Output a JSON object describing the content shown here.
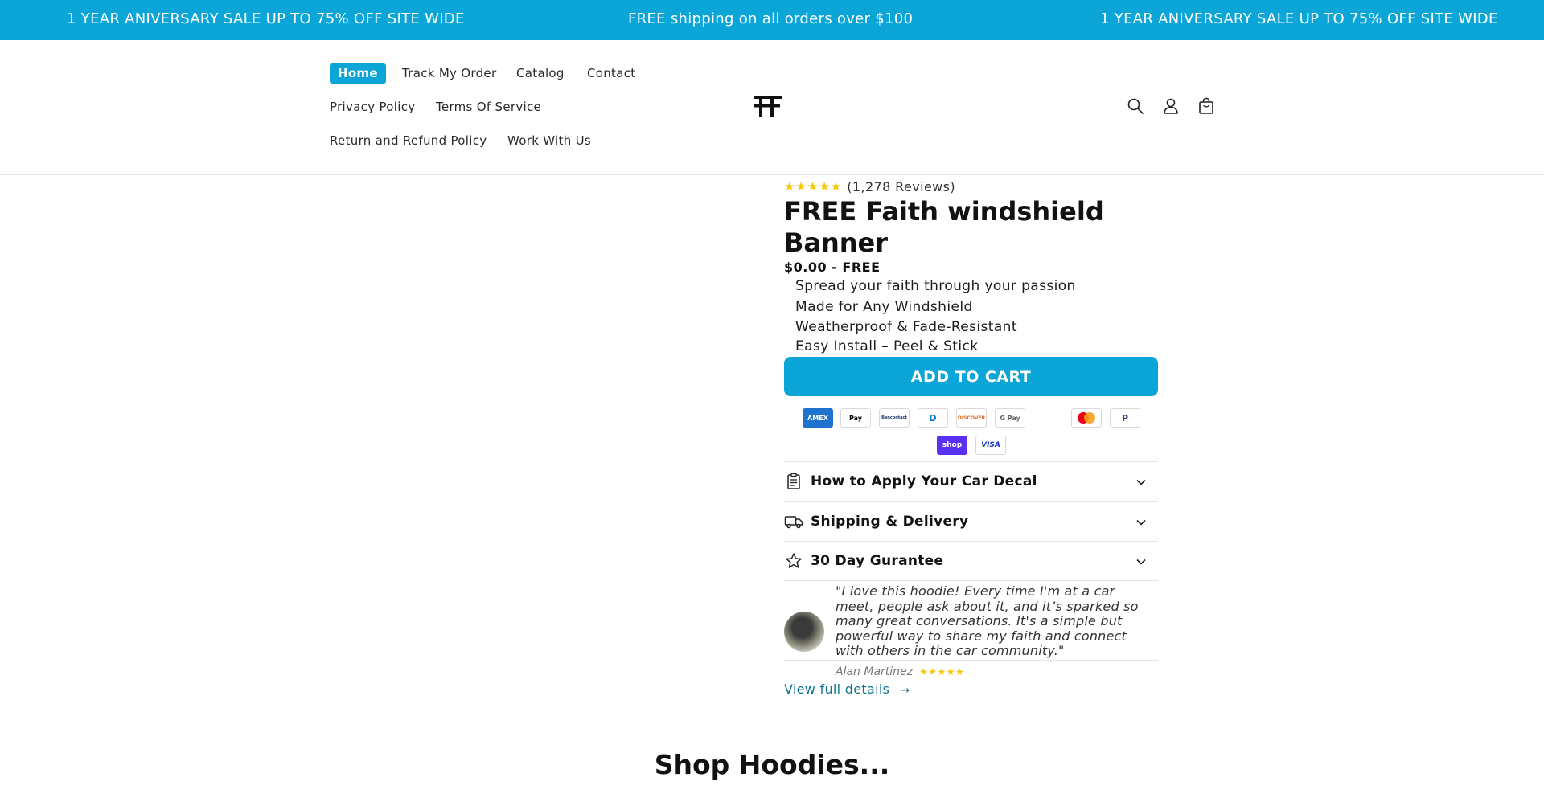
{
  "announcement": {
    "left": "1 YEAR ANIVERSARY SALE UP TO 75% OFF SITE WIDE",
    "center": "FREE shipping on all orders over $100",
    "right": "1 YEAR ANIVERSARY SALE UP TO 75% OFF SITE WIDE",
    "background": "#0ba6d7"
  },
  "nav": {
    "home": "Home",
    "track": "Track My Order",
    "catalog": "Catalog",
    "contact": "Contact",
    "privacy": "Privacy Policy",
    "terms": "Terms Of Service",
    "refund": "Return and Refund Policy",
    "work": "Work With Us"
  },
  "header_icons": [
    "search-icon",
    "account-icon",
    "cart-icon"
  ],
  "product": {
    "stars": "★★★★★",
    "reviews": "(1,278 Reviews)",
    "title": "FREE Faith windshield Banner",
    "price": "$0.00 - FREE",
    "bullets": [
      "Spread your faith through your passion",
      "Made for Any Windshield",
      "Weatherproof & Fade-Resistant",
      "Easy Install – Peel & Stick"
    ],
    "add_to_cart": "ADD TO CART"
  },
  "payment_methods": {
    "amex": "AMEX",
    "apple": "Pay",
    "bancontact": "Bancontact",
    "diners": "D",
    "discover": "DISCOVER",
    "gpay": "G Pay",
    "mastercard": "Mastercard",
    "paypal": "P",
    "shop": "shop",
    "visa": "VISA"
  },
  "accordions": [
    {
      "title": "How to Apply Your Car Decal",
      "icon": "clipboard-icon"
    },
    {
      "title": "Shipping & Delivery",
      "icon": "truck-icon"
    },
    {
      "title": "30 Day Gurantee",
      "icon": "star-outline-icon"
    }
  ],
  "review": {
    "quote": "\"I love this hoodie! Every time I'm at a car meet, people ask about it, and it’s sparked so many great conversations. It's a simple but powerful way to share my faith and connect with others in the car community.\"",
    "author": "Alan Martinez",
    "stars": "★★★★★"
  },
  "view_full_details": "View full details",
  "view_full_arrow": "→",
  "section_heading": "Shop Hoodies..."
}
